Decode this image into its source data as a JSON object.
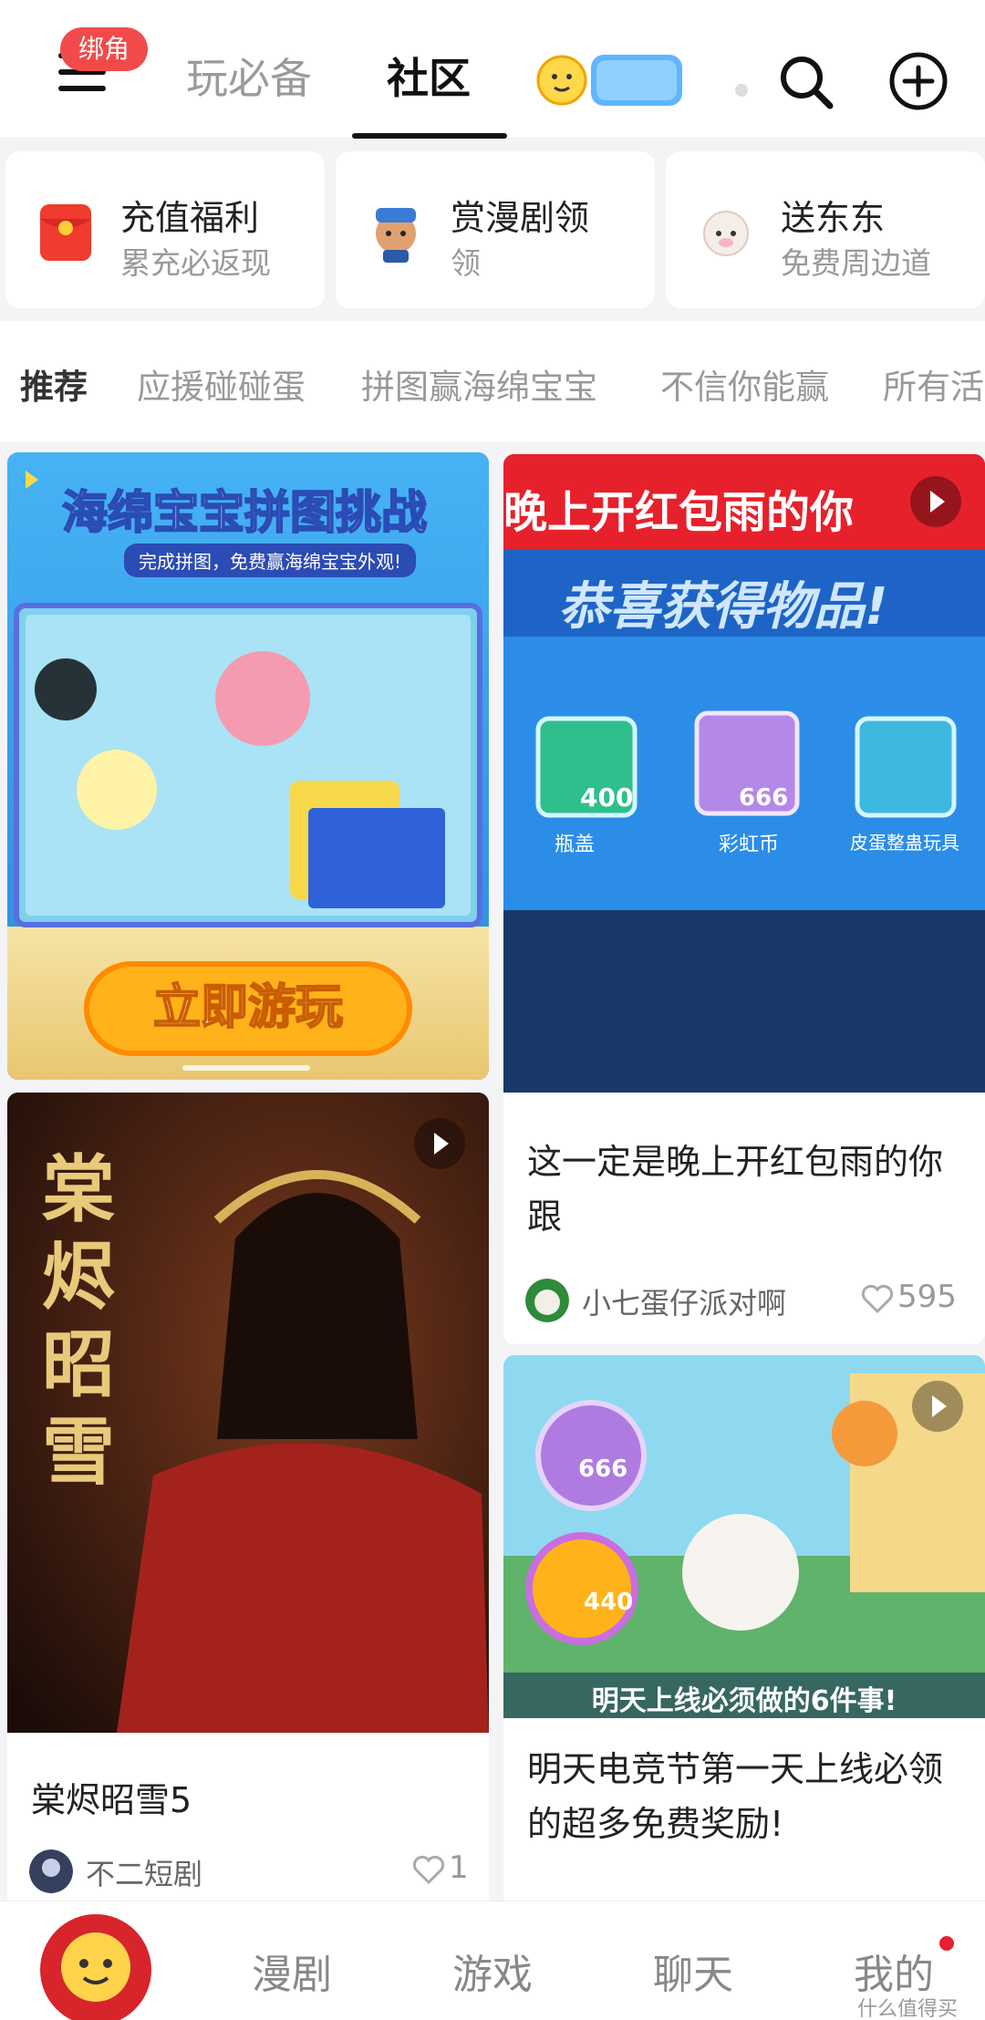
{
  "header": {
    "badge": "绑角",
    "tabs": [
      {
        "label": "玩必备"
      },
      {
        "label": "社区"
      }
    ]
  },
  "features": [
    {
      "title": "充值福利",
      "subtitle": "累充必返现",
      "icon": "red-envelope-icon"
    },
    {
      "title": "赏漫剧领",
      "subtitle": "领",
      "icon": "character-icon"
    },
    {
      "title": "送东东",
      "subtitle": "免费周边道",
      "icon": "sheep-icon"
    }
  ],
  "categories": [
    "推荐",
    "应援碰碰蛋",
    "拼图赢海绵宝宝",
    "不信你能赢",
    "所有活"
  ],
  "banner": {
    "title": "海绵宝宝拼图挑战",
    "subtitle": "完成拼图，免费赢海绵宝宝外观!",
    "cta": "立即游玩"
  },
  "cards": [
    {
      "overlay_top": "晚上开红包雨的你",
      "overlay_sub": "恭喜获得物品!",
      "items": [
        {
          "count": "400",
          "label": "瓶盖"
        },
        {
          "count": "666",
          "label": "彩虹币"
        },
        {
          "count": "",
          "label": "皮蛋整蛊玩具"
        }
      ],
      "title": "这一定是晚上开红包雨的你跟",
      "author": "小七蛋仔派对啊",
      "likes": "595"
    },
    {
      "cover_text": "棠烬昭雪",
      "title": "棠烬昭雪5",
      "author": "不二短剧",
      "likes": "1"
    },
    {
      "badges": [
        "666",
        "440"
      ],
      "caption": "明天上线必须做的6件事!",
      "title": "明天电竞节第一天上线必领的超多免费奖励!"
    }
  ],
  "bottom_nav": {
    "items": [
      "漫剧",
      "游戏",
      "聊天",
      "我的"
    ]
  },
  "watermark": "什么值得买",
  "colors": {
    "accent_red": "#f24a4a",
    "banner_blue": "#2f9be8",
    "cta_orange": "#ffb21a"
  }
}
